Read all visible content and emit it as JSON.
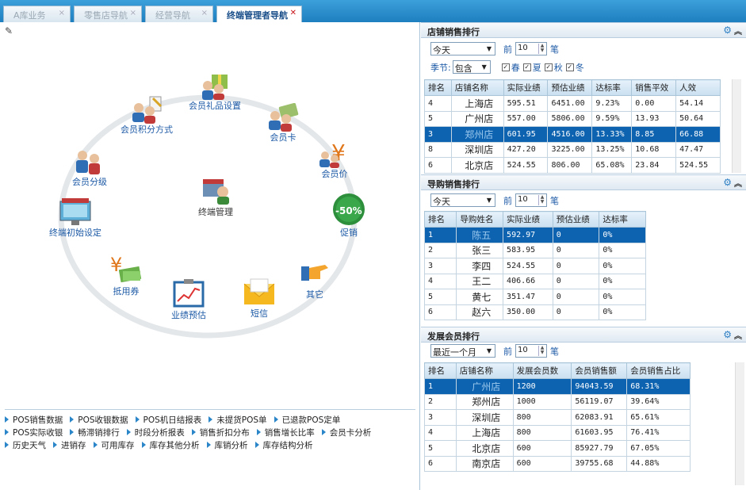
{
  "tabs": [
    {
      "label": "A库业务",
      "active": false
    },
    {
      "label": "零售店导航",
      "active": false
    },
    {
      "label": "经营导航",
      "active": false
    },
    {
      "label": "终端管理者导航",
      "active": true
    }
  ],
  "diagram": {
    "center": "终端管理",
    "nodes": {
      "gift": "会员礼品设置",
      "points": "会员积分方式",
      "card": "会员卡",
      "level": "会员分级",
      "price": "会员价",
      "promo": "促销",
      "init": "终端初始设定",
      "coupon": "抵用券",
      "forecast": "业绩预估",
      "sms": "短信",
      "other": "其它"
    },
    "promo_badge": "-50%"
  },
  "functions": [
    [
      "POS销售数据",
      "POS收银数据",
      "POS机日结报表",
      "未提货POS单",
      "已退款POS定单"
    ],
    [
      "POS实际收银",
      "畅滞销排行",
      "时段分析报表",
      "销售折扣分布",
      "销售增长比率",
      "会员卡分析"
    ],
    [
      "历史天气",
      "进销存",
      "可用库存",
      "库存其他分析",
      "库销分析",
      "库存结构分析"
    ]
  ],
  "store_panel": {
    "title": "店铺销售排行",
    "period": "今天",
    "prefix": "前",
    "topn": "10",
    "suffix": "笔",
    "season_label": "季节:",
    "season_mode": "包含",
    "seasons": [
      "春",
      "夏",
      "秋",
      "冬"
    ],
    "columns": [
      "排名",
      "店铺名称",
      "实际业绩",
      "预估业绩",
      "达标率",
      "销售平效",
      "人效"
    ],
    "rows": [
      [
        "4",
        "上海店",
        "595.51",
        "6451.00",
        "9.23%",
        "0.00",
        "54.14"
      ],
      [
        "5",
        "广州店",
        "557.00",
        "5806.00",
        "9.59%",
        "13.93",
        "50.64"
      ],
      [
        "3",
        "郑州店",
        "601.95",
        "4516.00",
        "13.33%",
        "8.85",
        "66.88"
      ],
      [
        "8",
        "深圳店",
        "427.20",
        "3225.00",
        "13.25%",
        "10.68",
        "47.47"
      ],
      [
        "6",
        "北京店",
        "524.55",
        "806.00",
        "65.08%",
        "23.84",
        "524.55"
      ]
    ],
    "highlight": 2
  },
  "guide_panel": {
    "title": "导购销售排行",
    "period": "今天",
    "prefix": "前",
    "topn": "10",
    "suffix": "笔",
    "columns": [
      "排名",
      "导购姓名",
      "实际业绩",
      "预估业绩",
      "达标率"
    ],
    "rows": [
      [
        "1",
        "陈五",
        "592.97",
        "0",
        "0%"
      ],
      [
        "2",
        "张三",
        "583.95",
        "0",
        "0%"
      ],
      [
        "3",
        "李四",
        "524.55",
        "0",
        "0%"
      ],
      [
        "4",
        "王二",
        "406.66",
        "0",
        "0%"
      ],
      [
        "5",
        "黄七",
        "351.47",
        "0",
        "0%"
      ],
      [
        "6",
        "赵六",
        "350.00",
        "0",
        "0%"
      ]
    ],
    "highlight": 0
  },
  "member_panel": {
    "title": "发展会员排行",
    "period": "最近一个月",
    "prefix": "前",
    "topn": "10",
    "suffix": "笔",
    "columns": [
      "排名",
      "店铺名称",
      "发展会员数",
      "会员销售额",
      "会员销售占比"
    ],
    "rows": [
      [
        "1",
        "广州店",
        "1200",
        "94043.59",
        "68.31%"
      ],
      [
        "2",
        "郑州店",
        "1000",
        "56119.07",
        "39.64%"
      ],
      [
        "3",
        "深圳店",
        "800",
        "62083.91",
        "65.61%"
      ],
      [
        "4",
        "上海店",
        "800",
        "61603.95",
        "76.41%"
      ],
      [
        "5",
        "北京店",
        "600",
        "85927.79",
        "67.05%"
      ],
      [
        "6",
        "南京店",
        "600",
        "39755.68",
        "44.88%"
      ]
    ],
    "highlight": 0
  }
}
